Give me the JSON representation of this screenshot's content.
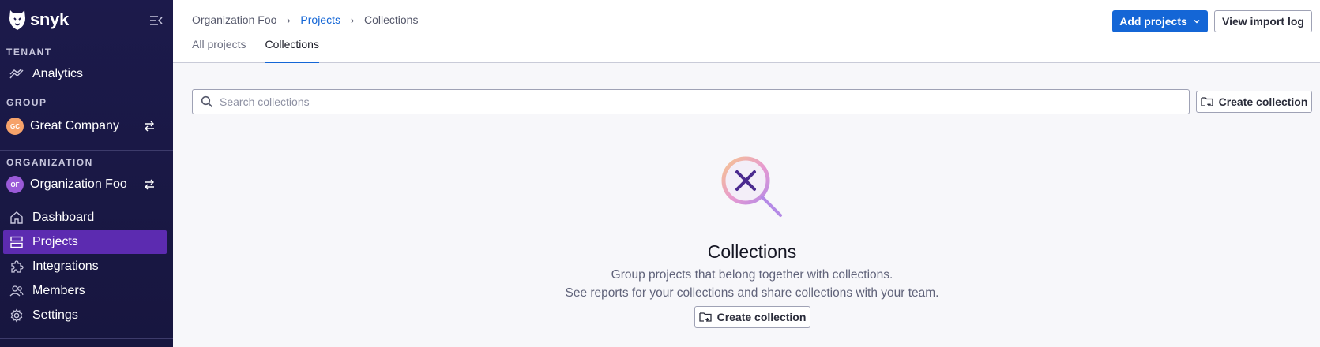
{
  "brand": {
    "name": "snyk"
  },
  "sidebar": {
    "tenant": {
      "label": "TENANT",
      "items": [
        {
          "label": "Analytics",
          "icon": "analytics-icon"
        }
      ]
    },
    "group": {
      "label": "GROUP",
      "name": "Great Company",
      "initials": "GC",
      "avatar_color": "#f6a26a"
    },
    "organization": {
      "label": "ORGANIZATION",
      "name": "Organization Foo",
      "initials": "OF",
      "avatar_color": "#9a5ad8"
    },
    "items": [
      {
        "label": "Dashboard",
        "icon": "home-icon",
        "active": false
      },
      {
        "label": "Projects",
        "icon": "projects-icon",
        "active": true
      },
      {
        "label": "Integrations",
        "icon": "puzzle-icon",
        "active": false
      },
      {
        "label": "Members",
        "icon": "members-icon",
        "active": false
      },
      {
        "label": "Settings",
        "icon": "gear-icon",
        "active": false
      }
    ]
  },
  "header": {
    "breadcrumb": [
      "Organization Foo",
      "Projects",
      "Collections"
    ],
    "tabs": [
      {
        "label": "All projects",
        "active": false
      },
      {
        "label": "Collections",
        "active": true
      }
    ],
    "add_projects_label": "Add projects",
    "view_import_log_label": "View import log"
  },
  "main": {
    "search": {
      "placeholder": "Search collections",
      "value": ""
    },
    "create_collection_label": "Create collection",
    "empty_state": {
      "title": "Collections",
      "line1": "Group projects that belong together with collections.",
      "line2": "See reports for your collections and share collections with your team.",
      "button_label": "Create collection"
    }
  },
  "colors": {
    "accent": "#1466d6",
    "sidebar_bg": "#1c1a4b",
    "active_nav": "#5c2bb0"
  }
}
